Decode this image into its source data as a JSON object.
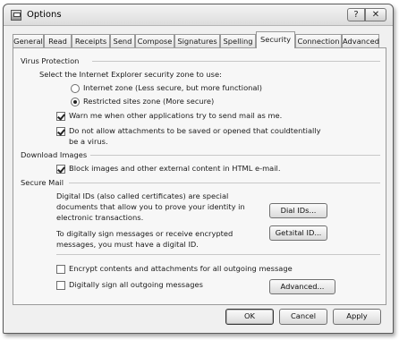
{
  "window": {
    "title": "Options",
    "help_label": "?",
    "close_label": "✕",
    "icon": "app-icon"
  },
  "tabs": [
    {
      "label": "General"
    },
    {
      "label": "Read"
    },
    {
      "label": "Receipts"
    },
    {
      "label": "Send"
    },
    {
      "label": "Compose"
    },
    {
      "label": "Signatures"
    },
    {
      "label": "Spelling"
    },
    {
      "label": "Security",
      "active": true
    },
    {
      "label": "Connection"
    },
    {
      "label": "Advanced"
    }
  ],
  "virus": {
    "heading": "Virus Protection",
    "zone_prompt": "Select the Internet Explorer security zone to use:",
    "zone_internet": "Internet zone (Less secure, but more functional)",
    "zone_restricted": "Restricted sites zone (More secure)",
    "selected_zone": "restricted",
    "warn_label": "Warn me when other applications try to send mail as me.",
    "warn_checked": true,
    "attach_label_1": "Do not allow attachments to be saved or opened that couldtentially",
    "attach_label_2": "be a virus.",
    "attach_checked": true
  },
  "download": {
    "heading": "Download Images",
    "block_label": "Block images and other external content in HTML e-mail.",
    "block_checked": true
  },
  "secure": {
    "heading": "Secure Mail",
    "digital_id_text_1": "Digital IDs (also called certificates) are special",
    "digital_id_text_2": "documents that allow you to prove your identity in",
    "digital_id_text_3": "electronic transactions.",
    "digital_ids_button": "Dial IDs...",
    "sign_text_1": "To digitally sign messages or receive encrypted",
    "sign_text_2": "messages, you must have a digital ID.",
    "get_id_button": "Getɜital ID...",
    "encrypt_label": "Encrypt contents and attachments for all outgoing message",
    "encrypt_checked": false,
    "sign_label": "Digitally sign all outgoing messages",
    "sign_checked": false,
    "advanced_button": "Advanced..."
  },
  "footer": {
    "ok": "OK",
    "cancel": "Cancel",
    "apply": "Apply"
  }
}
